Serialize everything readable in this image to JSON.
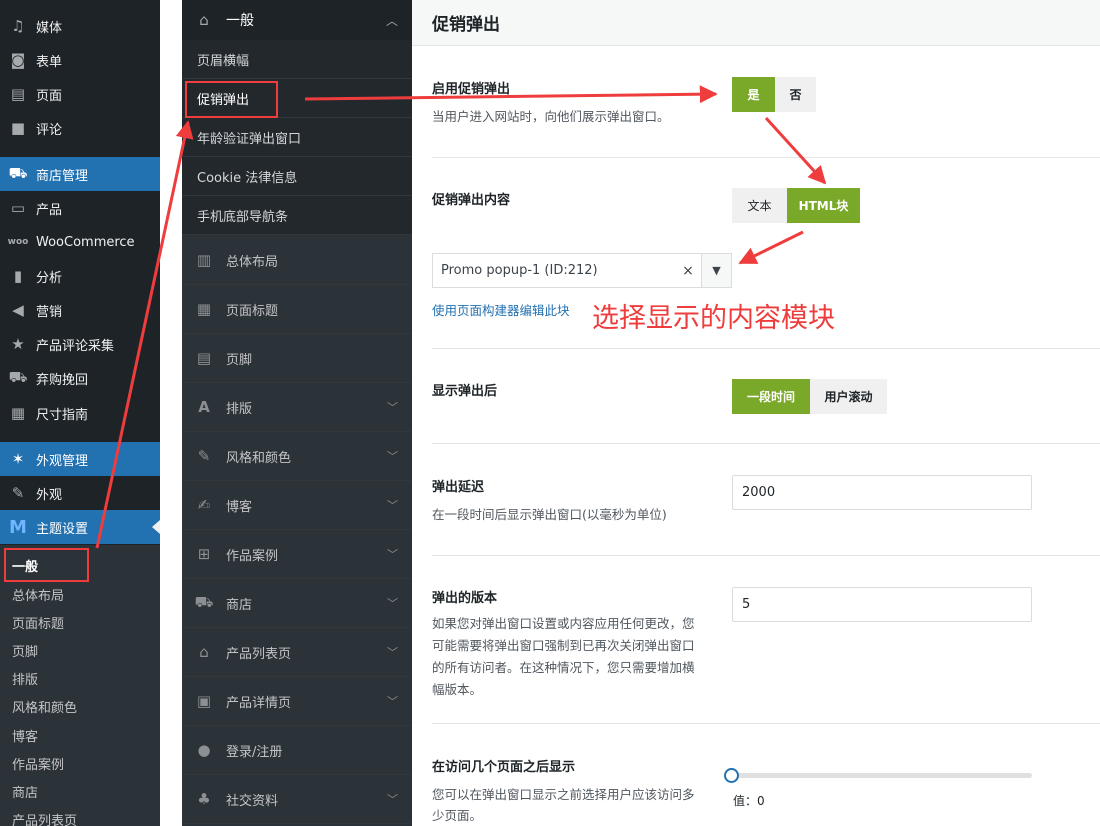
{
  "wp_menu": {
    "items": [
      {
        "icon": "media-icon",
        "label": "媒体"
      },
      {
        "icon": "form-icon",
        "label": "表单"
      },
      {
        "icon": "page-icon",
        "label": "页面"
      },
      {
        "icon": "comment-icon",
        "label": "评论"
      },
      {
        "icon": "cart-icon",
        "label": "商店管理"
      },
      {
        "icon": "archive-icon",
        "label": "产品"
      },
      {
        "icon": "woo-icon",
        "label": "WooCommerce"
      },
      {
        "icon": "bar-chart-icon",
        "label": "分析"
      },
      {
        "icon": "megaphone-icon",
        "label": "营销"
      },
      {
        "icon": "star-icon",
        "label": "产品评论采集"
      },
      {
        "icon": "cart-icon",
        "label": "弃购挽回"
      },
      {
        "icon": "ruler-icon",
        "label": "尺寸指南"
      },
      {
        "icon": "palm-icon",
        "label": "外观管理"
      },
      {
        "icon": "hammer-icon",
        "label": "外观"
      },
      {
        "icon": "theme-logo-icon",
        "label": "主题设置"
      }
    ],
    "submenu": [
      "一般",
      "总体布局",
      "页面标题",
      "页脚",
      "排版",
      "风格和颜色",
      "博客",
      "作品案例",
      "商店",
      "产品列表页"
    ]
  },
  "panel": {
    "head_label": "一般",
    "subs": [
      "页眉横幅",
      "促销弹出",
      "年龄验证弹出窗口",
      "Cookie 法律信息",
      "手机底部导航条"
    ],
    "sections": [
      "总体布局",
      "页面标题",
      "页脚",
      "排版",
      "风格和颜色",
      "博客",
      "作品案例",
      "商店",
      "产品列表页",
      "产品详情页",
      "登录/注册",
      "社交资料"
    ]
  },
  "main": {
    "title": "促销弹出",
    "enable": {
      "title": "启用促销弹出",
      "desc": "当用户进入网站时，向他们展示弹出窗口。",
      "yes": "是",
      "no": "否"
    },
    "content": {
      "title": "促销弹出内容",
      "opt_text": "文本",
      "opt_html": "HTML块",
      "select_value": "Promo popup-1 (ID:212)",
      "clear": "×",
      "link": "使用页面构建器编辑此块"
    },
    "show_after": {
      "title": "显示弹出后",
      "opt_time": "一段时间",
      "opt_scroll": "用户滚动"
    },
    "delay": {
      "title": "弹出延迟",
      "desc": "在一段时间后显示弹出窗口(以毫秒为单位)",
      "value": "2000"
    },
    "version": {
      "title": "弹出的版本",
      "desc_lines": [
        "如果您对弹出窗口设置或内容应用任何更改，您",
        "可能需要将弹出窗口强制到已再次关闭弹出窗口",
        "的所有访问者。在这种情况下，您只需要增加横",
        "幅版本。"
      ],
      "value": "5"
    },
    "pages": {
      "title": "在访问几个页面之后显示",
      "desc_lines": [
        "您可以在弹出窗口显示之前选择用户应该访问多",
        "少页面。"
      ],
      "value_label": "值：",
      "value": "0"
    }
  },
  "annotation": {
    "text": "选择显示的内容模块",
    "color": "#ef3d3d"
  },
  "colors": {
    "accent_green": "#7aa92a",
    "wp_blue": "#2271b1",
    "sidebar_dark": "#1d2327"
  }
}
